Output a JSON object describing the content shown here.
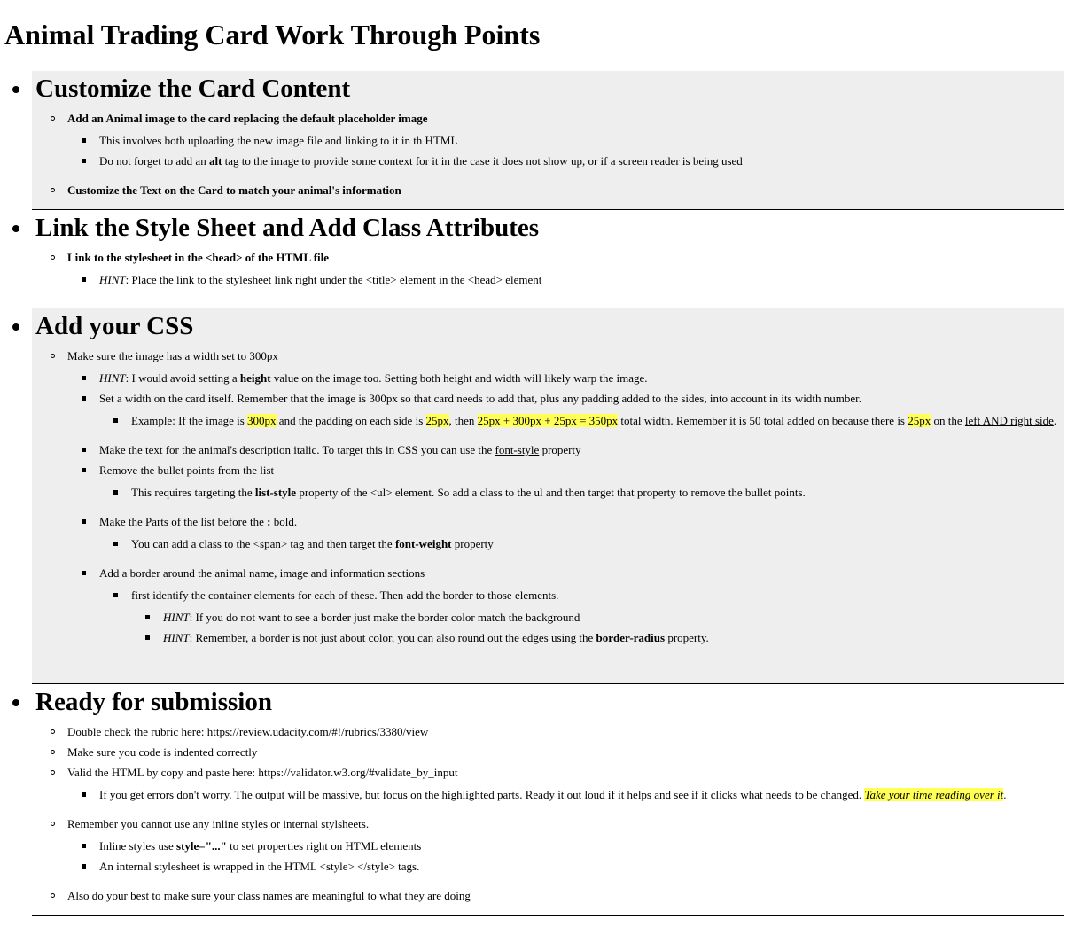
{
  "page_title": "Animal Trading Card Work Through Points",
  "sections": {
    "s1": {
      "title": "Customize the Card Content",
      "item1": "Add an Animal image to the card replacing the default placeholder image",
      "item1_sub1": "This involves both uploading the new image file and linking to it in th HTML",
      "item1_sub2_a": "Do not forget to add an ",
      "item1_sub2_b": "alt",
      "item1_sub2_c": " tag to the image to provide some context for it in the case it does not show up, or if a screen reader is being used",
      "item2": "Customize the Text on the Card to match your animal's information"
    },
    "s2": {
      "title": "Link the Style Sheet and Add Class Attributes",
      "item1": "Link to the stylesheet in the <head> of the HTML file",
      "item1_sub1_hint": "HINT",
      "item1_sub1_text": ": Place the link to the stylesheet link right under the <title> element in the <head> element"
    },
    "s3": {
      "title": "Add your CSS",
      "item1": "Make sure the image has a width set to 300px",
      "hint1_label": "HINT",
      "hint1_a": ": I would avoid setting a ",
      "hint1_b": "height",
      "hint1_c": " value on the image too. Setting both height and width will likely warp the image.",
      "width_note": "Set a width on the card itself. Remember that the image is 300px so that card needs to add that, plus any padding added to the sides, into account in its width number.",
      "example_a": "Example: If the image is ",
      "example_hl1": "300px",
      "example_b": " and the padding on each side is ",
      "example_hl2": "25px",
      "example_c": ", then ",
      "example_hl3": "25px + 300px + 25px = 350px",
      "example_d": " total width. Remember it is 50 total added on because there is ",
      "example_hl4": "25px",
      "example_e": " on the ",
      "example_u": "left AND right side",
      "example_f": ".",
      "italic_a": "Make the text for the animal's description italic. To target this in CSS you can use the ",
      "italic_u": "font-style",
      "italic_b": " property",
      "bullets": "Remove the bullet points from the list",
      "bullets_sub_a": "This requires targeting the ",
      "bullets_sub_b": "list-style",
      "bullets_sub_c": " property of the <ul> element. So add a class to the ul and then target that property to remove the bullet points.",
      "parts_a": "Make the Parts of the list before the ",
      "parts_b": ":",
      "parts_c": " bold.",
      "parts_sub_a": "You can add a class to the <span> tag and then target the ",
      "parts_sub_b": "font-weight",
      "parts_sub_c": " property",
      "border": "Add a border around the animal name, image and information sections",
      "border_sub": "first identify the container elements for each of these. Then add the border to those elements.",
      "border_hint1_label": "HINT",
      "border_hint1_text": ": If you do not want to see a border just make the border color match the background",
      "border_hint2_label": "HINT",
      "border_hint2_a": ": Remember, a border is not just about color, you can also round out the edges using the ",
      "border_hint2_b": "border-radius",
      "border_hint2_c": " property."
    },
    "s4": {
      "title": "Ready for submission",
      "item1": "Double check the rubric here: https://review.udacity.com/#!/rubrics/3380/view",
      "item2": "Make sure you code is indented correctly",
      "item3": "Valid the HTML by copy and paste here: https://validator.w3.org/#validate_by_input",
      "item3_sub_a": "If you get errors don't worry. The output will be massive, but focus on the highlighted parts. Ready it out loud if it helps and see if it clicks what needs to be changed. ",
      "item3_sub_hl": "Take your time reading over it",
      "item3_sub_b": ".",
      "item4": "Remember you cannot use any inline styles or internal stylsheets.",
      "item4_sub1_a": "Inline styles use ",
      "item4_sub1_b": "style=\"...\"",
      "item4_sub1_c": " to set properties right on HTML elements",
      "item4_sub2": "An internal stylesheet is wrapped in the HTML <style> </style> tags.",
      "item5": "Also do your best to make sure your class names are meaningful to what they are doing"
    }
  },
  "colors": {
    "shaded_background": "#eeeeee",
    "highlight": "#ffff55"
  }
}
